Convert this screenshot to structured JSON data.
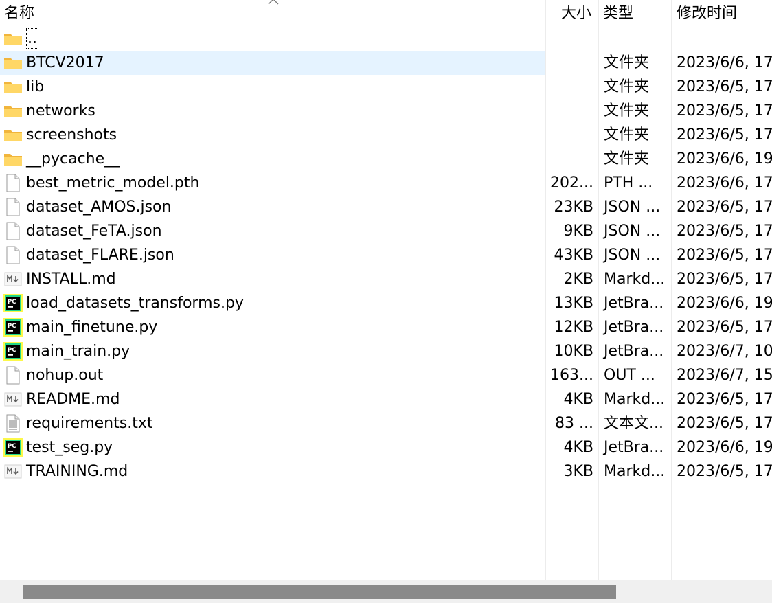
{
  "header": {
    "name": "名称",
    "size": "大小",
    "type": "类型",
    "modified": "修改时间"
  },
  "colors": {
    "selection": "#e5f3ff",
    "folder": "#f8c94a",
    "pycharm_green": "#21d789",
    "scrollbar_thumb": "#8a8a8a"
  },
  "rows": [
    {
      "name": "..",
      "size": "",
      "type": "",
      "date": "",
      "icon": "folder-icon"
    },
    {
      "name": "BTCV2017",
      "size": "",
      "type": "文件夹",
      "date": "2023/6/6, 17",
      "icon": "folder-icon"
    },
    {
      "name": "lib",
      "size": "",
      "type": "文件夹",
      "date": "2023/6/5, 17",
      "icon": "folder-icon"
    },
    {
      "name": "networks",
      "size": "",
      "type": "文件夹",
      "date": "2023/6/5, 17",
      "icon": "folder-icon"
    },
    {
      "name": "screenshots",
      "size": "",
      "type": "文件夹",
      "date": "2023/6/5, 17",
      "icon": "folder-icon"
    },
    {
      "name": "__pycache__",
      "size": "",
      "type": "文件夹",
      "date": "2023/6/6, 19",
      "icon": "folder-icon"
    },
    {
      "name": "best_metric_model.pth",
      "size": "202...",
      "type": "PTH ...",
      "date": "2023/6/6, 17",
      "icon": "file-icon"
    },
    {
      "name": "dataset_AMOS.json",
      "size": "23KB",
      "type": "JSON ...",
      "date": "2023/6/5, 17",
      "icon": "file-icon"
    },
    {
      "name": "dataset_FeTA.json",
      "size": "9KB",
      "type": "JSON ...",
      "date": "2023/6/5, 17",
      "icon": "file-icon"
    },
    {
      "name": "dataset_FLARE.json",
      "size": "43KB",
      "type": "JSON ...",
      "date": "2023/6/5, 17",
      "icon": "file-icon"
    },
    {
      "name": "INSTALL.md",
      "size": "2KB",
      "type": "Markd...",
      "date": "2023/6/5, 17",
      "icon": "markdown-icon"
    },
    {
      "name": "load_datasets_transforms.py",
      "size": "13KB",
      "type": "JetBra...",
      "date": "2023/6/6, 19",
      "icon": "pycharm-icon"
    },
    {
      "name": "main_finetune.py",
      "size": "12KB",
      "type": "JetBra...",
      "date": "2023/6/5, 17",
      "icon": "pycharm-icon"
    },
    {
      "name": "main_train.py",
      "size": "10KB",
      "type": "JetBra...",
      "date": "2023/6/7, 10",
      "icon": "pycharm-icon"
    },
    {
      "name": "nohup.out",
      "size": "163...",
      "type": "OUT ...",
      "date": "2023/6/7, 15",
      "icon": "file-icon"
    },
    {
      "name": "README.md",
      "size": "4KB",
      "type": "Markd...",
      "date": "2023/6/5, 17",
      "icon": "markdown-icon"
    },
    {
      "name": "requirements.txt",
      "size": "83 ...",
      "type": "文本文...",
      "date": "2023/6/5, 17",
      "icon": "text-file-icon"
    },
    {
      "name": "test_seg.py",
      "size": "4KB",
      "type": "JetBra...",
      "date": "2023/6/6, 19",
      "icon": "pycharm-icon"
    },
    {
      "name": "TRAINING.md",
      "size": "3KB",
      "type": "Markd...",
      "date": "2023/6/5, 17",
      "icon": "markdown-icon"
    }
  ],
  "selected_index": 1,
  "focused_index": 0
}
